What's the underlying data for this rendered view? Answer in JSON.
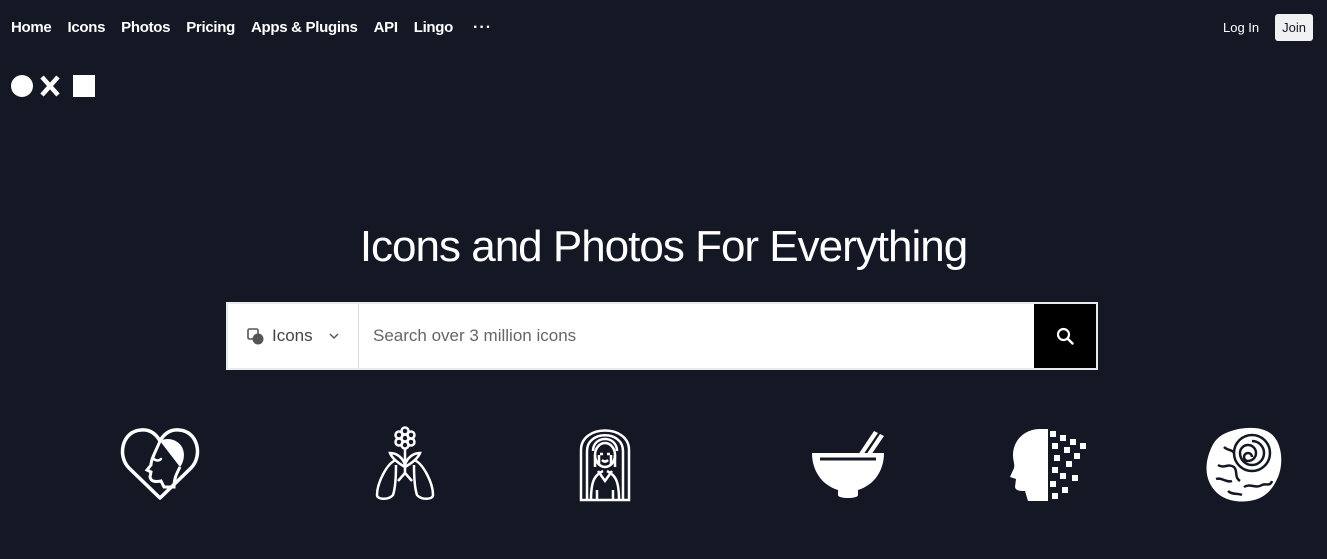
{
  "nav": {
    "items": [
      {
        "label": "Home"
      },
      {
        "label": "Icons"
      },
      {
        "label": "Photos"
      },
      {
        "label": "Pricing"
      },
      {
        "label": "Apps & Plugins"
      },
      {
        "label": "API"
      },
      {
        "label": "Lingo"
      }
    ],
    "more": "···",
    "login": "Log In",
    "join": "Join"
  },
  "logo": {
    "icon": "circle-x-square-logo"
  },
  "hero": {
    "title": "Icons and Photos For Everything"
  },
  "search": {
    "type_label": "Icons",
    "placeholder": "Search over 3 million icons"
  },
  "showcase": [
    {
      "icon": "heart-face-icon"
    },
    {
      "icon": "flower-lungs-icon"
    },
    {
      "icon": "woman-arch-icon"
    },
    {
      "icon": "bowl-chopsticks-icon"
    },
    {
      "icon": "head-pixels-icon"
    },
    {
      "icon": "fossil-rock-icon"
    }
  ],
  "colors": {
    "background": "#141824",
    "accent": "#000000",
    "text": "#ffffff"
  }
}
